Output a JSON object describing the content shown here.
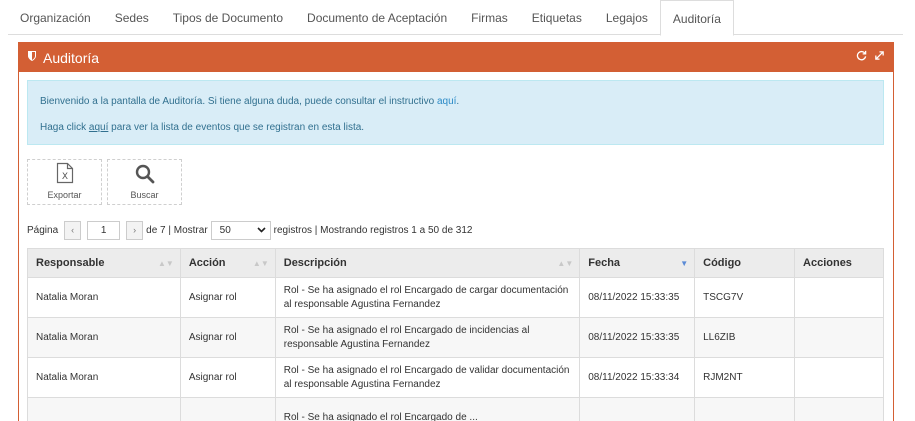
{
  "tabs": [
    "Organización",
    "Sedes",
    "Tipos de Documento",
    "Documento de Aceptación",
    "Firmas",
    "Etiquetas",
    "Legajos",
    "Auditoría"
  ],
  "active_tab": "Auditoría",
  "panel": {
    "title": "Auditoría",
    "header_color": "#d35f34"
  },
  "info": {
    "line1_prefix": "Bienvenido a la pantalla de Auditoría. Si tiene alguna duda, puede consultar el instructivo ",
    "line1_link": "aquí",
    "line1_suffix": ".",
    "line2_prefix": "Haga click ",
    "line2_link": "aquí",
    "line2_suffix": " para ver la lista de eventos que se registran en esta lista."
  },
  "toolbar": {
    "export_label": "Exportar",
    "search_label": "Buscar"
  },
  "pager": {
    "page_label": "Página",
    "current_page": "1",
    "of_text": "de 7 | Mostrar",
    "per_page": "50",
    "summary": "registros | Mostrando registros 1 a 50 de 312"
  },
  "table": {
    "headers": [
      "Responsable",
      "Acción",
      "Descripción",
      "Fecha",
      "Código",
      "Acciones"
    ],
    "rows": [
      [
        "Natalia Moran",
        "Asignar rol",
        "Rol - Se ha asignado el rol Encargado de cargar documentación al responsable Agustina Fernandez",
        "08/11/2022 15:33:35",
        "TSCG7V",
        ""
      ],
      [
        "Natalia Moran",
        "Asignar rol",
        "Rol - Se ha asignado el rol Encargado de incidencias al responsable Agustina Fernandez",
        "08/11/2022 15:33:35",
        "LL6ZIB",
        ""
      ],
      [
        "Natalia Moran",
        "Asignar rol",
        "Rol - Se ha asignado el rol Encargado de validar documentación al responsable Agustina Fernandez",
        "08/11/2022 15:33:34",
        "RJM2NT",
        ""
      ],
      [
        "",
        "",
        "Rol - Se ha asignado el rol Encargado de ...",
        "",
        "",
        ""
      ]
    ]
  }
}
